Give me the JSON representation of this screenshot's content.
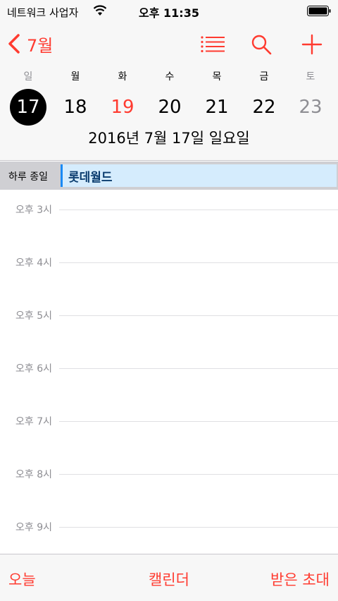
{
  "status_bar": {
    "carrier": "네트워크 사업자",
    "time": "오후 11:35"
  },
  "nav": {
    "back_label": "7월",
    "icons": [
      "chevron-left-icon",
      "list-icon",
      "search-icon",
      "plus-icon"
    ],
    "accent_color": "#ff3b30"
  },
  "week": {
    "weekdays": [
      "일",
      "월",
      "화",
      "수",
      "목",
      "금",
      "토"
    ],
    "dates": [
      "17",
      "18",
      "19",
      "20",
      "21",
      "22",
      "23"
    ],
    "selected": "17",
    "today": "19",
    "full_date": "2016년 7월 17일 일요일"
  },
  "allday": {
    "label": "하루 종일",
    "event": "롯데월드",
    "event_color": "#1a8af5"
  },
  "timeline": {
    "hours": [
      "오후 3시",
      "오후 4시",
      "오후 5시",
      "오후 6시",
      "오후 7시",
      "오후 8시",
      "오후 9시"
    ]
  },
  "tabs": {
    "today": "오늘",
    "calendars": "캘린더",
    "inbox": "받은 초대"
  }
}
